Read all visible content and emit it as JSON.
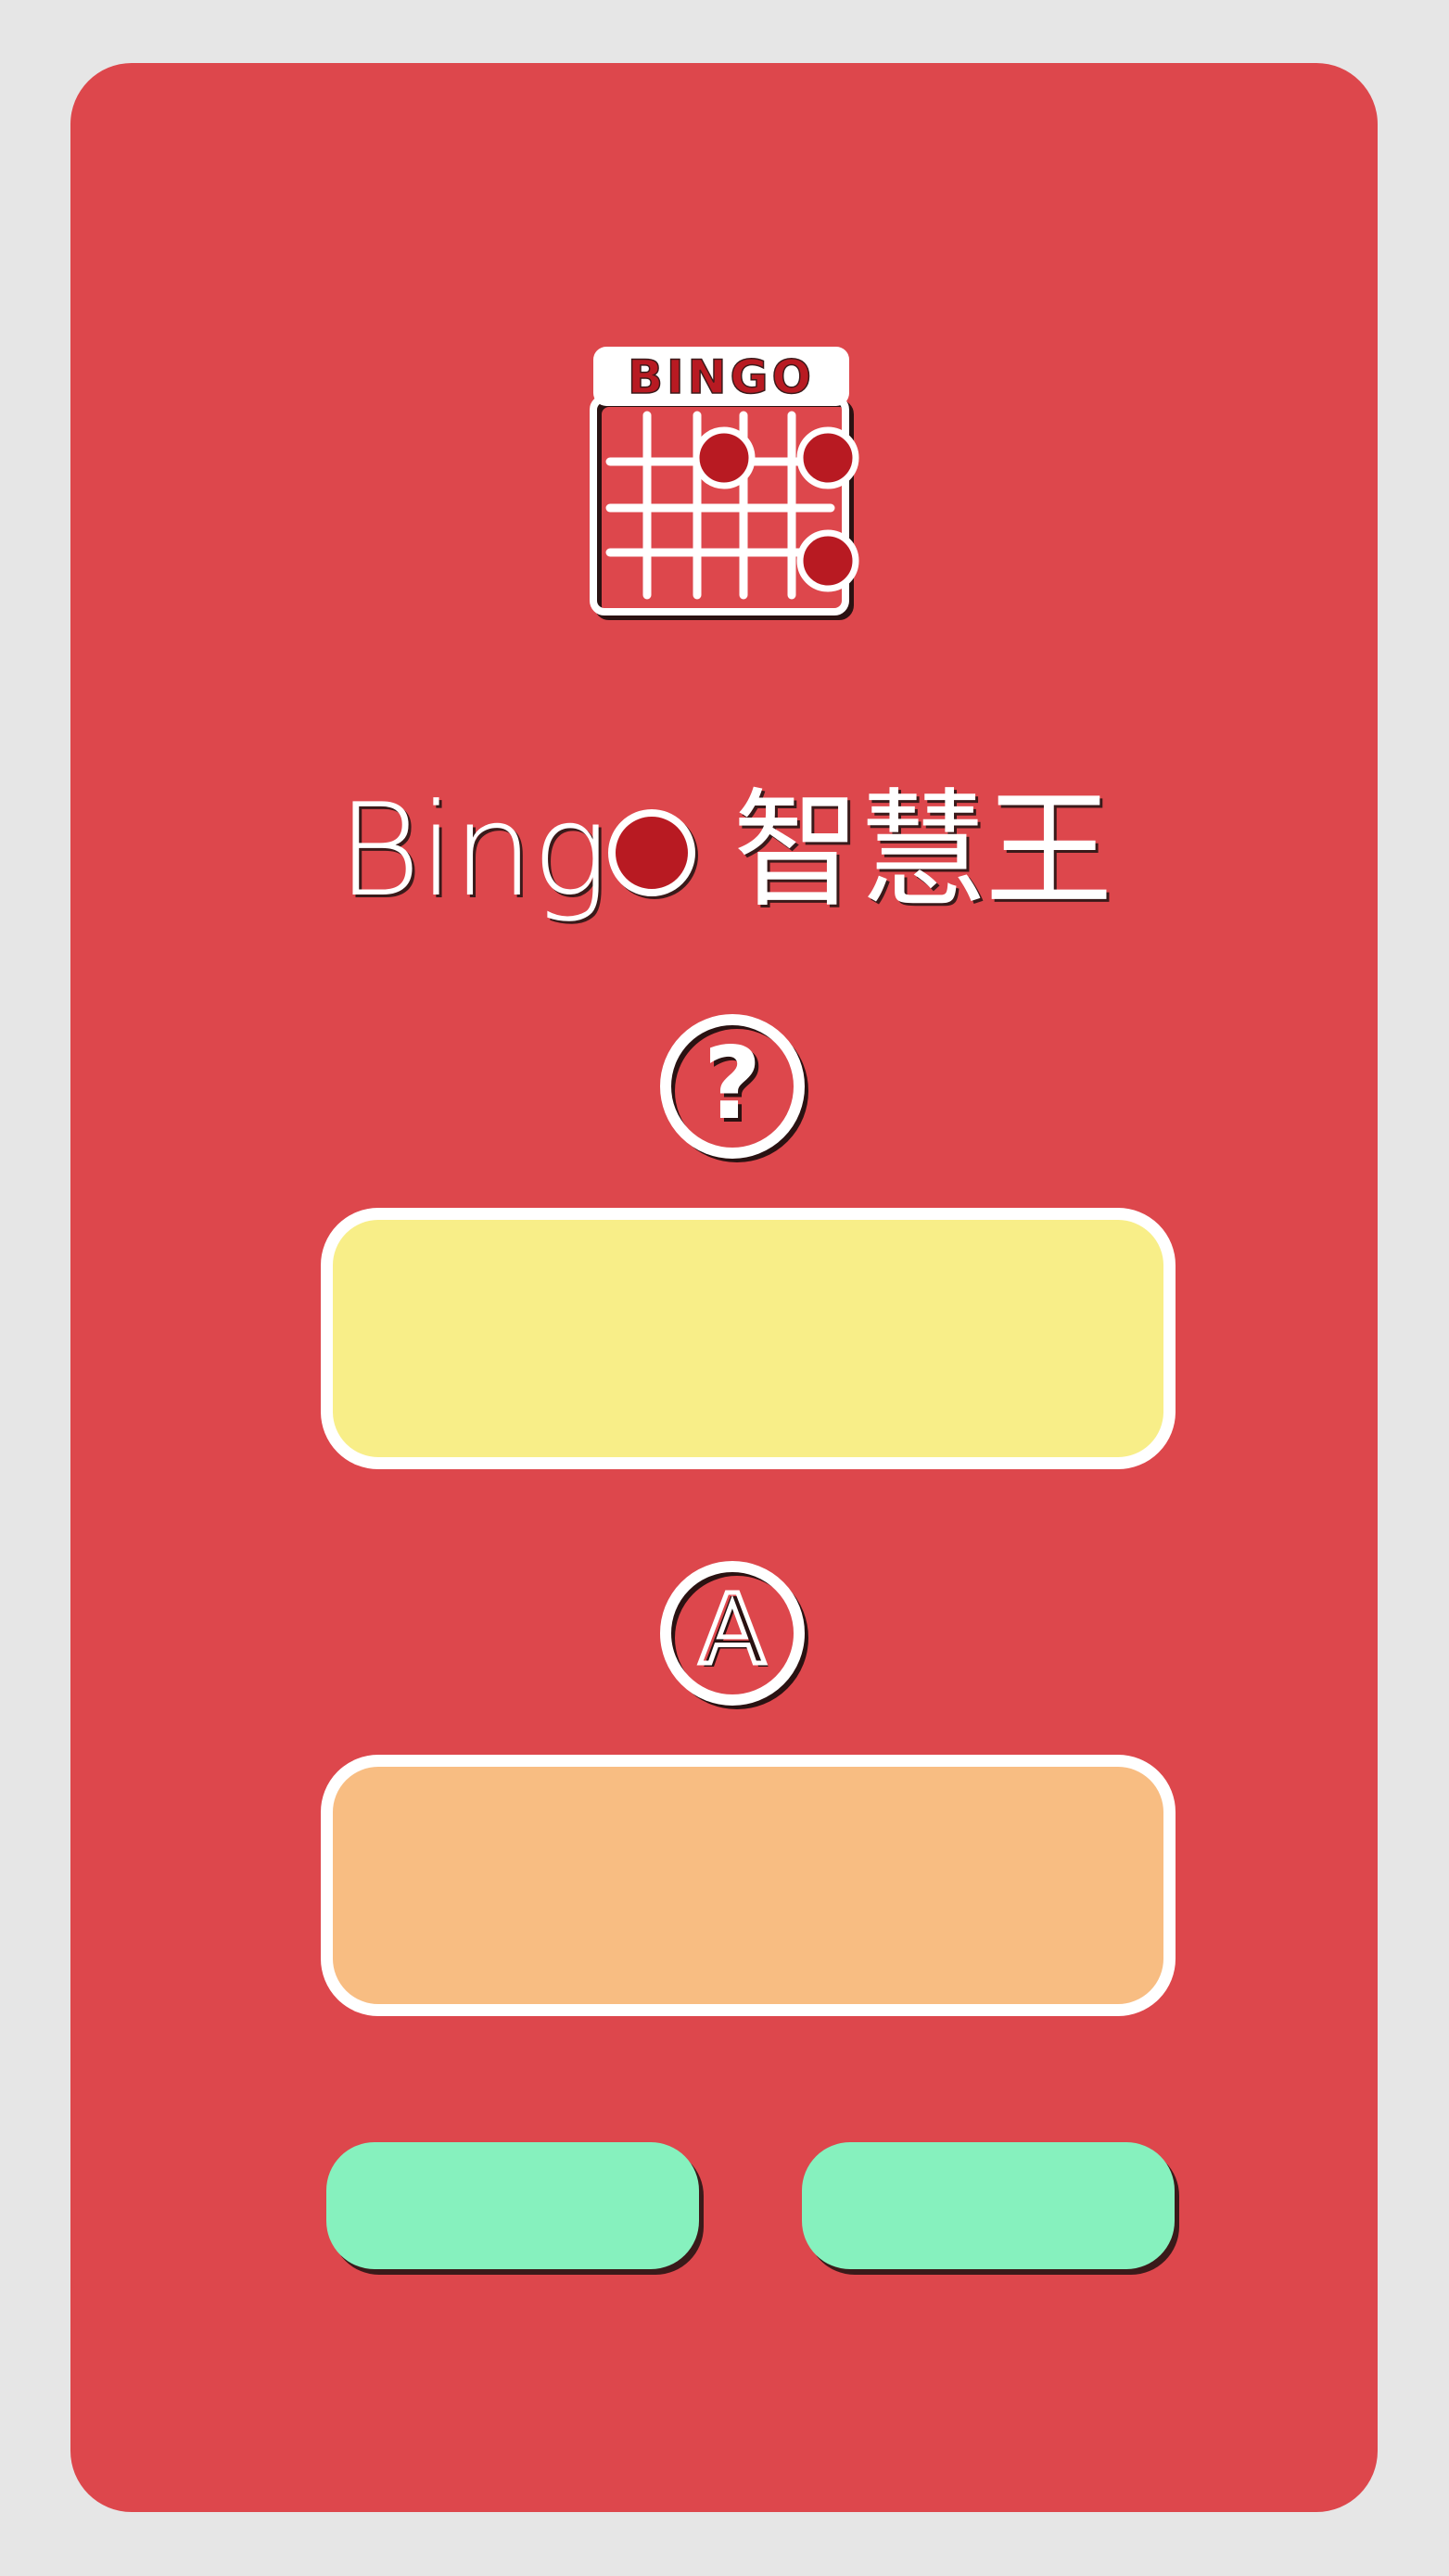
{
  "app": {
    "logo_text": "BINGO",
    "title_prefix": "Bing",
    "title_suffix": "智慧王"
  },
  "question": {
    "icon": "question-circle-icon",
    "glyph": "?",
    "value": ""
  },
  "answer": {
    "icon": "letter-a-circle-icon",
    "glyph": "A",
    "value": ""
  },
  "buttons": {
    "left_label": "",
    "right_label": ""
  },
  "colors": {
    "background": "#e6e6e6",
    "card": "#dd474c",
    "question_box": "#f8ee88",
    "answer_box": "#f8bd82",
    "button": "#86f1be",
    "bingo_dot": "#b81a22"
  }
}
